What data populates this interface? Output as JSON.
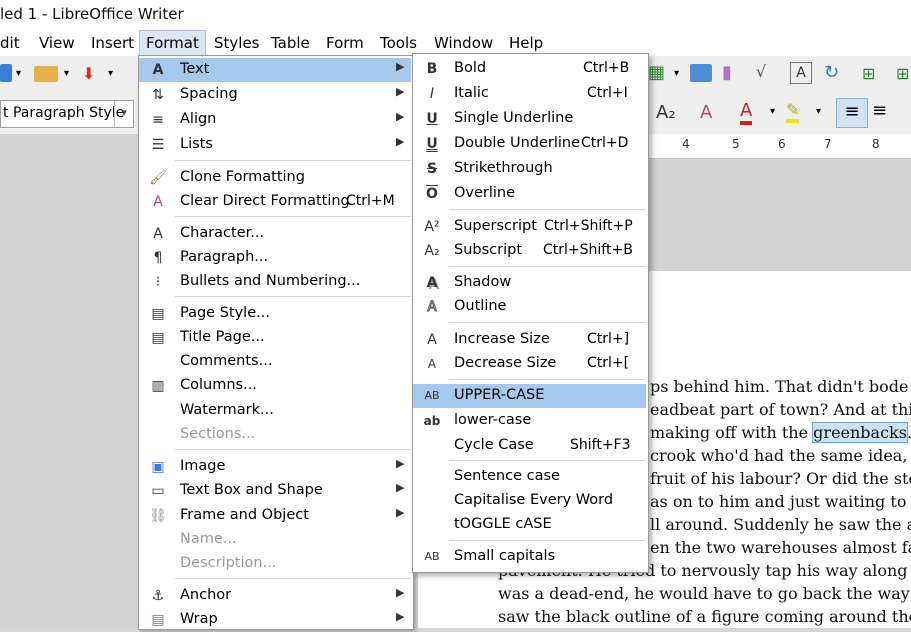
{
  "window": {
    "title": "led 1 - LibreOffice Writer"
  },
  "menubar": {
    "items": [
      "dit",
      "View",
      "Insert",
      "Format",
      "Styles",
      "Table",
      "Form",
      "Tools",
      "Window",
      "Help"
    ]
  },
  "toolbar": {
    "paragraph_style": "t Paragraph Style"
  },
  "ruler": {
    "numbers": [
      "4",
      "5",
      "6",
      "7",
      "8"
    ]
  },
  "format_menu": {
    "items": [
      {
        "label": "Text"
      },
      {
        "label": "Spacing"
      },
      {
        "label": "Align"
      },
      {
        "label": "Lists"
      },
      {
        "label": "Clone Formatting"
      },
      {
        "label": "Clear Direct Formatting",
        "shortcut": "Ctrl+M"
      },
      {
        "label": "Character..."
      },
      {
        "label": "Paragraph..."
      },
      {
        "label": "Bullets and Numbering..."
      },
      {
        "label": "Page Style..."
      },
      {
        "label": "Title Page..."
      },
      {
        "label": "Comments..."
      },
      {
        "label": "Columns..."
      },
      {
        "label": "Watermark..."
      },
      {
        "label": "Sections..."
      },
      {
        "label": "Image"
      },
      {
        "label": "Text Box and Shape"
      },
      {
        "label": "Frame and Object"
      },
      {
        "label": "Name..."
      },
      {
        "label": "Description..."
      },
      {
        "label": "Anchor"
      },
      {
        "label": "Wrap"
      }
    ]
  },
  "text_submenu": {
    "items": [
      {
        "label": "Bold",
        "shortcut": "Ctrl+B",
        "icon": "B"
      },
      {
        "label": "Italic",
        "shortcut": "Ctrl+I",
        "icon": "I"
      },
      {
        "label": "Single Underline",
        "shortcut": "",
        "icon": "U"
      },
      {
        "label": "Double Underline",
        "shortcut": "Ctrl+D",
        "icon": "U"
      },
      {
        "label": "Strikethrough",
        "shortcut": "",
        "icon": "S"
      },
      {
        "label": "Overline",
        "shortcut": "",
        "icon": "O"
      },
      {
        "label": "Superscript",
        "shortcut": "Ctrl+Shift+P",
        "icon": "A²"
      },
      {
        "label": "Subscript",
        "shortcut": "Ctrl+Shift+B",
        "icon": "A₂"
      },
      {
        "label": "Shadow",
        "shortcut": "",
        "icon": "A"
      },
      {
        "label": "Outline",
        "shortcut": "",
        "icon": "A"
      },
      {
        "label": "Increase Size",
        "shortcut": "Ctrl+]",
        "icon": "A"
      },
      {
        "label": "Decrease Size",
        "shortcut": "Ctrl+[",
        "icon": "A"
      },
      {
        "label": "UPPER-CASE",
        "shortcut": "",
        "icon": "AB"
      },
      {
        "label": "lower-case",
        "shortcut": "",
        "icon": "ab"
      },
      {
        "label": "Cycle Case",
        "shortcut": "Shift+F3",
        "icon": ""
      },
      {
        "label": "Sentence case",
        "shortcut": "",
        "icon": ""
      },
      {
        "label": "Capitalise Every Word",
        "shortcut": "",
        "icon": ""
      },
      {
        "label": "tOGGLE cASE",
        "shortcut": "",
        "icon": ""
      },
      {
        "label": "Small capitals",
        "shortcut": "",
        "icon": "AB"
      }
    ]
  },
  "document": {
    "lines": [
      "ps behind him. That didn't bode w",
      "eadbeat part of town? And at this",
      "making off with the ",
      "crook who'd had the same idea, a",
      "fruit of his labour? Or did the ste",
      "as on to him and just waiting to p",
      "ll around. Suddenly he saw the a",
      "en the two warehouses almost fal",
      "pavement. He tried to nervously tap his way along i",
      "was a dead-end, he would have to go back the way h",
      "saw the black outline of a figure coming around the"
    ],
    "selected_word": "greenbacks",
    "after_selection": ". ¶"
  }
}
